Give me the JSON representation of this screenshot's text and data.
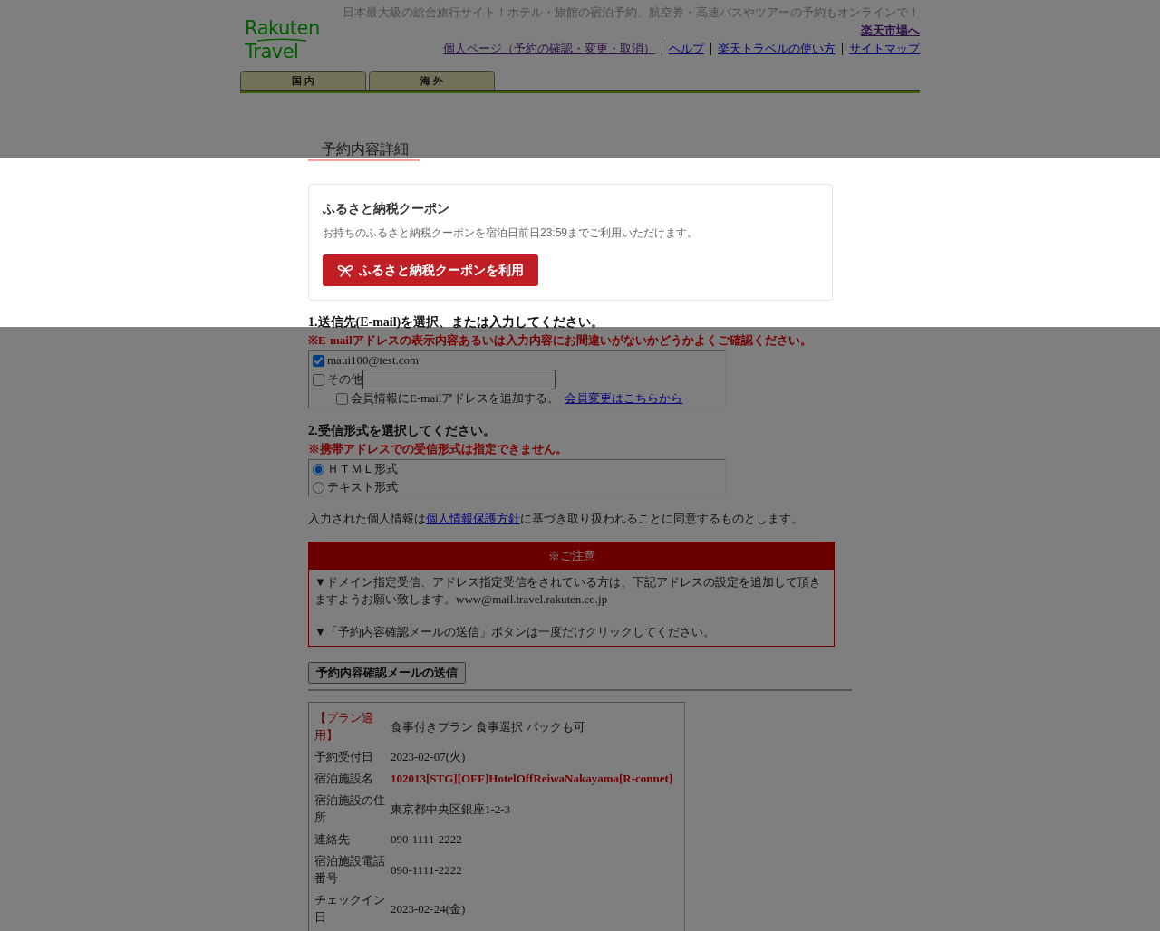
{
  "header": {
    "logo": [
      "Rakuten",
      "Travel"
    ],
    "tagline": "日本最大級の総合旅行サイト！ホテル・旅館の宿泊予約、航空券・高速バスやツアーの予約もオンラインで！",
    "market_link": {
      "label": "楽天市場へ",
      "visited": true
    },
    "links": [
      {
        "label": "個人ページ（予約の確認・変更・取消）",
        "visited": true
      },
      {
        "label": "ヘルプ",
        "visited": false
      },
      {
        "label": "楽天トラベルの使い方",
        "visited": false
      },
      {
        "label": "サイトマップ",
        "visited": false
      }
    ]
  },
  "tabs": [
    {
      "label": "国 内",
      "selected": false
    },
    {
      "label": "海 外",
      "selected": false
    }
  ],
  "page_title": "予約内容詳細",
  "coupon": {
    "highlighted": true,
    "title": "ふるさと納税クーポン",
    "description": "お持ちのふるさと納税クーポンを宿泊日前日23:59までご利用いただけます。",
    "button": "ふるさと納税クーポンを利用"
  },
  "recipient": {
    "heading": "1.送信先(E-mail)を選択、または入力してください。",
    "warning": "※E-mailアドレスの表示内容あるいは入力内容にお間違いがないかどうかよくご確認ください。",
    "options": [
      {
        "kind": "address",
        "label": "maui100@test.com",
        "checked": true
      },
      {
        "kind": "other",
        "label": "その他",
        "checked": false
      }
    ],
    "add_to_profile": {
      "label": "会員情報にE-mailアドレスを追加する。",
      "checked": false,
      "link": {
        "label": "会員変更はこちらから",
        "visited": false
      }
    }
  },
  "format": {
    "heading": "2.受信形式を選択してください。",
    "warning": "※携帯アドレスでの受信形式は指定できません。",
    "options": [
      {
        "label": "ＨＴＭＬ形式",
        "selected": true
      },
      {
        "label": "テキスト形式",
        "selected": false
      }
    ]
  },
  "consent": {
    "before": "入力された個人情報は",
    "link": {
      "label": "個人情報保護方針",
      "visited": false
    },
    "after": "に基づき取り扱われることに同意するものとします。"
  },
  "notice": {
    "title": "※ご注意",
    "items": [
      "▼ドメイン指定受信、アドレス指定受信をされている方は、下記アドレスの設定を追加して頂きますようお願い致します。www@mail.travel.rakuten.co.jp",
      "▼「予約内容確認メールの送信」ボタンは一度だけクリックしてください。"
    ]
  },
  "send_button": "予約内容確認メールの送信",
  "details": {
    "rows": [
      {
        "kind": "plan",
        "label": "【プラン適用】",
        "value": "食事付きプラン 食事選択 パックも可"
      },
      {
        "kind": "normal",
        "label": "予約受付日",
        "value": "2023-02-07(火)"
      },
      {
        "kind": "facility",
        "label": "宿泊施設名",
        "value": "102013[STG][OFF]HotelOffReiwaNakayama[R-connet]"
      },
      {
        "kind": "normal",
        "label": "宿泊施設の住所",
        "value": "東京都中央区銀座1-2-3"
      },
      {
        "kind": "normal",
        "label": "連絡先",
        "value": "090-1111-2222"
      },
      {
        "kind": "normal",
        "label": "宿泊施設電話番号",
        "value": "090-1111-2222"
      },
      {
        "kind": "normal",
        "label": "チェックイン日",
        "value": "2023-02-24(金)"
      }
    ]
  }
}
